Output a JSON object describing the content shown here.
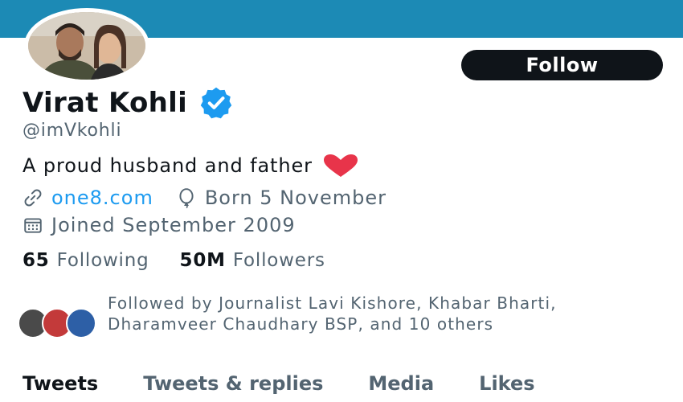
{
  "colors": {
    "banner": "#1c8ab5",
    "accent": "#1d9bf0",
    "verified": "#1d9bf0",
    "heart": "#e8344a",
    "follow_button": "#0f1419"
  },
  "profile": {
    "name": "Virat Kohli",
    "handle": "@imVkohli",
    "bio": "A proud husband and father",
    "bio_emoji": "red-heart",
    "website": "one8.com",
    "birthday": "Born 5 November",
    "joined": "Joined September 2009",
    "verified": true
  },
  "actions": {
    "follow_label": "Follow"
  },
  "stats": {
    "following_count": "65",
    "following_label": "Following",
    "followers_count": "50M",
    "followers_label": "Followers"
  },
  "followed_by": {
    "text": "Followed by Journalist Lavi Kishore, Khabar Bharti, Dharamveer Chaudhary BSP, and 10 others"
  },
  "tabs": [
    "Tweets",
    "Tweets & replies",
    "Media",
    "Likes"
  ],
  "active_tab": "Tweets",
  "icons": {
    "website": "link-icon",
    "birthday": "balloon-icon",
    "joined": "calendar-icon"
  }
}
